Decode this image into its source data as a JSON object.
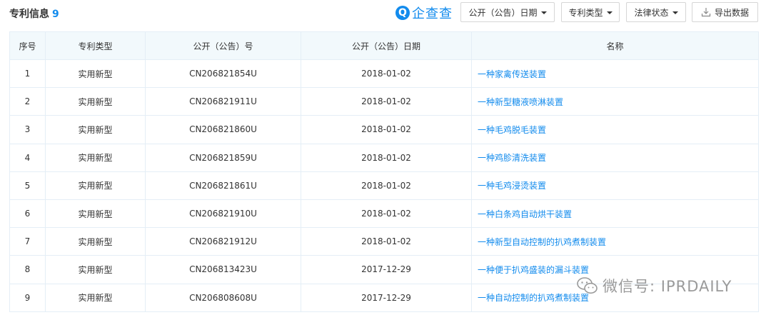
{
  "header": {
    "title": "专利信息",
    "count": "9"
  },
  "brand": {
    "logo_letter": "Q",
    "name": "企查查"
  },
  "filters": {
    "date_label": "公开（公告）日期",
    "type_label": "专利类型",
    "status_label": "法律状态",
    "export_label": "导出数据"
  },
  "table": {
    "columns": [
      "序号",
      "专利类型",
      "公开（公告）号",
      "公开（公告）日期",
      "名称"
    ],
    "rows": [
      {
        "index": "1",
        "type": "实用新型",
        "number": "CN206821854U",
        "date": "2018-01-02",
        "name": "一种家禽传送装置"
      },
      {
        "index": "2",
        "type": "实用新型",
        "number": "CN206821911U",
        "date": "2018-01-02",
        "name": "一种新型糖液喷淋装置"
      },
      {
        "index": "3",
        "type": "实用新型",
        "number": "CN206821860U",
        "date": "2018-01-02",
        "name": "一种毛鸡脱毛装置"
      },
      {
        "index": "4",
        "type": "实用新型",
        "number": "CN206821859U",
        "date": "2018-01-02",
        "name": "一种鸡胗清洗装置"
      },
      {
        "index": "5",
        "type": "实用新型",
        "number": "CN206821861U",
        "date": "2018-01-02",
        "name": "一种毛鸡浸烫装置"
      },
      {
        "index": "6",
        "type": "实用新型",
        "number": "CN206821910U",
        "date": "2018-01-02",
        "name": "一种白条鸡自动烘干装置"
      },
      {
        "index": "7",
        "type": "实用新型",
        "number": "CN206821912U",
        "date": "2018-01-02",
        "name": "一种新型自动控制的扒鸡煮制装置"
      },
      {
        "index": "8",
        "type": "实用新型",
        "number": "CN206813423U",
        "date": "2017-12-29",
        "name": "一种便于扒鸡盛装的漏斗装置"
      },
      {
        "index": "9",
        "type": "实用新型",
        "number": "CN206808608U",
        "date": "2017-12-29",
        "name": "一种自动控制的扒鸡煮制装置"
      }
    ]
  },
  "watermark": {
    "text": "微信号: IPRDAILY",
    "icon": "wechat-icon"
  },
  "colors": {
    "accent": "#128bed",
    "header_bg": "#f2f9fc",
    "border": "#e4eef6"
  }
}
